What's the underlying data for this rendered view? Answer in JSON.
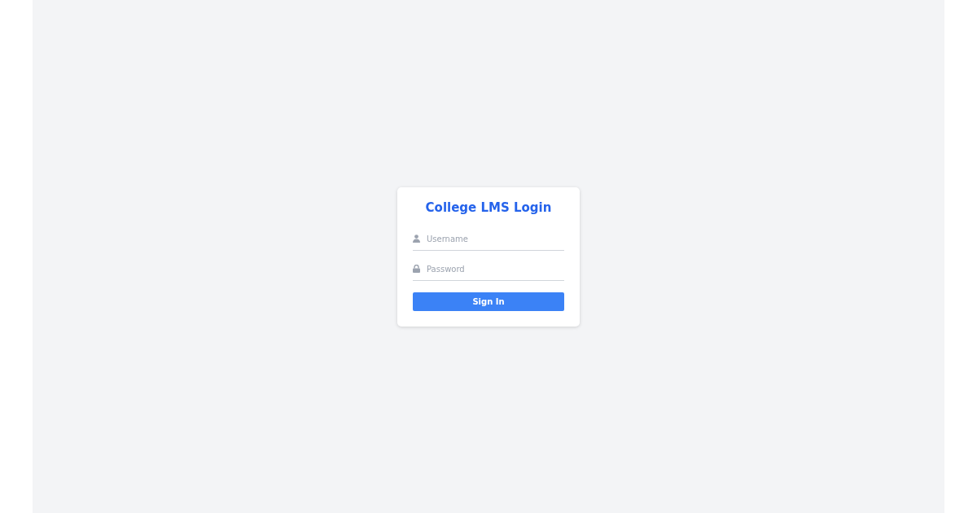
{
  "title": "College LMS Login",
  "fields": [
    {
      "kind": "user",
      "placeholder": "Username"
    },
    {
      "kind": "lock",
      "placeholder": "Password"
    }
  ],
  "button": "Sign In"
}
